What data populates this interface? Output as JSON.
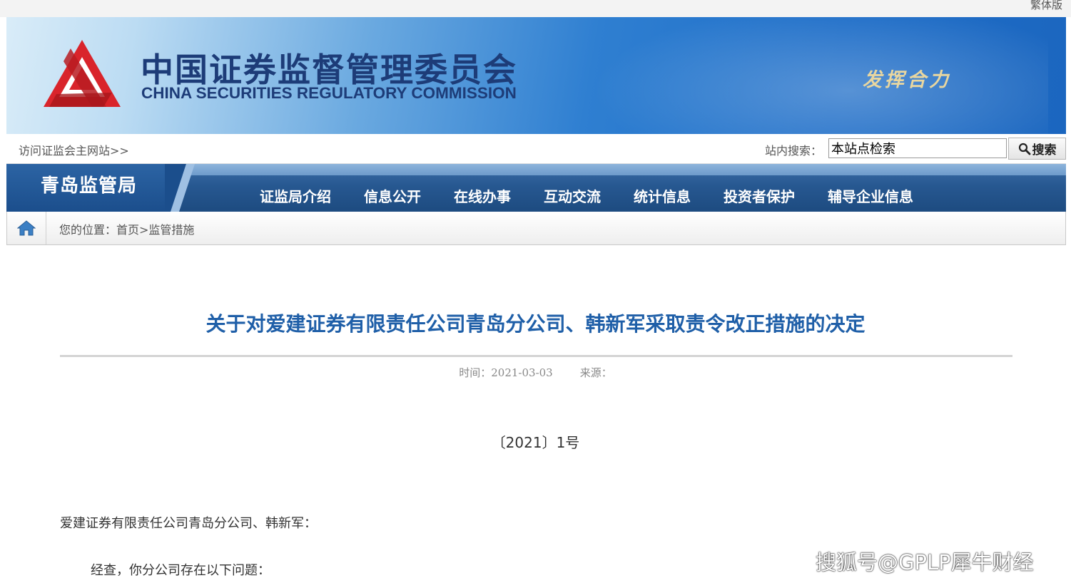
{
  "header": {
    "traditional_link": "繁体版",
    "org_name_cn": "中国证券监督管理委员会",
    "org_name_en": "CHINA SECURITIES REGULATORY COMMISSION",
    "slogan": "发挥合力",
    "logo_color": "#d9242b"
  },
  "search": {
    "main_site_link": "访问证监会主网站>>",
    "label": "站内搜索：",
    "value": "本站点检索",
    "button_label": "搜索"
  },
  "nav": {
    "bureau_name": "青岛监管局",
    "items": [
      "证监局介绍",
      "信息公开",
      "在线办事",
      "互动交流",
      "统计信息",
      "投资者保护",
      "辅导企业信息"
    ]
  },
  "breadcrumb": {
    "text": "您的位置：首页>监管措施"
  },
  "article": {
    "title": "关于对爱建证券有限责任公司青岛分公司、韩新军采取责令改正措施的决定",
    "time": "时间：2021-03-03",
    "source": "来源：",
    "doc_number": "〔2021〕1号",
    "salutation": "爱建证券有限责任公司青岛分公司、韩新军：",
    "paragraph_1": "经查，你分公司存在以下问题："
  },
  "watermark": "搜狐号@GPLP犀牛财经",
  "colors": {
    "title_blue": "#1f5fa8",
    "nav_blue": "#275891",
    "brand_red": "#d9242b"
  }
}
